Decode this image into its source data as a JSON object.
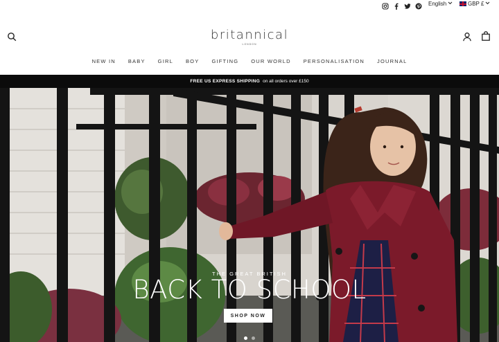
{
  "utility": {
    "social": [
      "instagram-icon",
      "facebook-icon",
      "twitter-icon",
      "pinterest-icon"
    ],
    "language": "English",
    "currency": "GBP £"
  },
  "header": {
    "logo_word": "britannical",
    "logo_sub": "LONDON",
    "nav": [
      "NEW IN",
      "BABY",
      "GIRL",
      "BOY",
      "GIFTING",
      "OUR WORLD",
      "PERSONALISATION",
      "JOURNAL"
    ]
  },
  "announcement": {
    "bold": "FREE US EXPRESS SHIPPING",
    "rest": "on all orders over £150"
  },
  "hero": {
    "eyebrow": "THE GREAT BRITISH",
    "title": "BACK TO SCHOOL",
    "cta": "SHOP NOW",
    "slides": 2,
    "active_slide": 1
  },
  "colors": {
    "announcement_bg": "#0b0b0b",
    "coat": "#7b1a2a",
    "railing": "#141414"
  }
}
